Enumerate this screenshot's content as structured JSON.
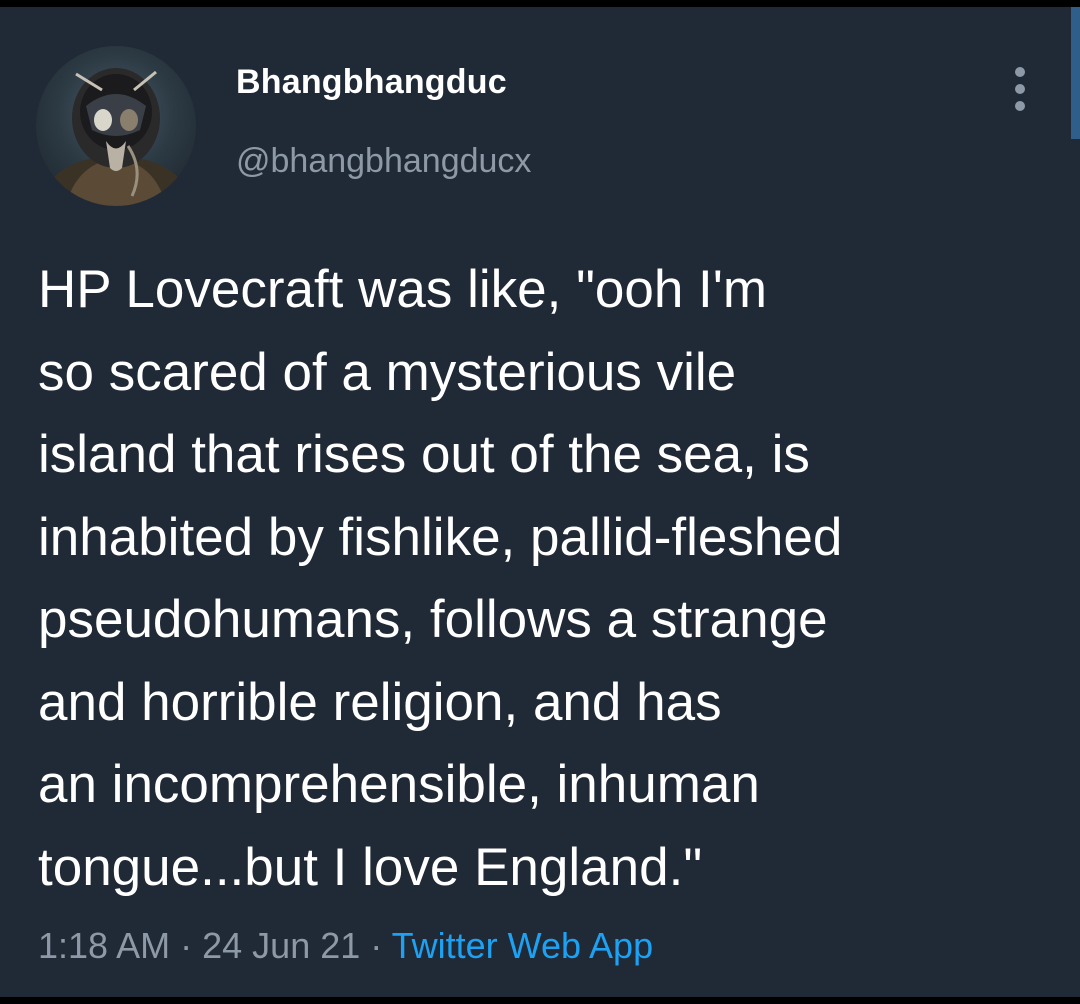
{
  "tweet": {
    "display_name": "Bhangbhangduc",
    "handle": "@bhangbhangducx",
    "text_lines": [
      "HP Lovecraft was like, \"ooh I'm",
      "so scared of a mysterious vile",
      "island that rises out of the sea, is",
      "inhabited by fishlike, pallid-fleshed",
      "pseudohumans, follows a strange",
      "and horrible religion, and has",
      "an incomprehensible, inhuman",
      "tongue...but I love England.\""
    ],
    "time": "1:18 AM",
    "separator": "·",
    "date": "24 Jun 21",
    "source": "Twitter Web App"
  },
  "icons": {
    "avatar": "astronaut-helmet-avatar",
    "more": "more-vertical-icon"
  },
  "colors": {
    "background": "#202936",
    "primary_text": "#ffffff",
    "secondary_text": "#8d99a6",
    "link": "#1da1f2"
  }
}
